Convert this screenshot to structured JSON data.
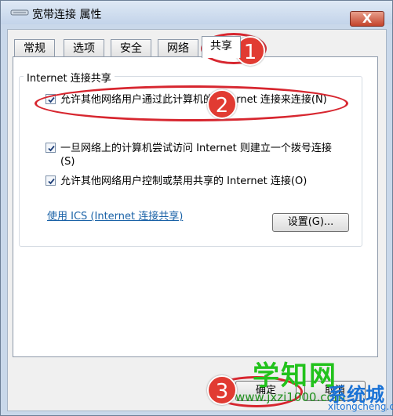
{
  "window": {
    "title": "宽带连接 属性",
    "close_symbol": "X",
    "icon": "network-connection-icon"
  },
  "tabs": [
    "常规",
    "选项",
    "安全",
    "网络",
    "共享"
  ],
  "group": {
    "title": "Internet 连接共享",
    "options": [
      {
        "label": "允许其他网络用户通过此计算机的 Internet 连接来连接(N)",
        "checked": true
      },
      {
        "label": "一旦网络上的计算机尝试访问 Internet 则建立一个拨号连接(S)",
        "checked": true
      },
      {
        "label": "允许其他网络用户控制或禁用共享的 Internet 连接(O)",
        "checked": true
      }
    ],
    "link": "使用 ICS (Internet 连接共享)",
    "settings_button": "设置(G)..."
  },
  "footer": {
    "ok": "确定",
    "cancel": "取消"
  },
  "annotations": [
    "1",
    "2",
    "3"
  ],
  "watermark": {
    "big": "学知网",
    "site": "www.jxzi1000.com",
    "brand": "系统城",
    "sub": "xitongcheng.com"
  },
  "colors": {
    "annotation_red": "#e13b32",
    "link_blue": "#1a62a7",
    "watermark_green": "#22c21c"
  }
}
